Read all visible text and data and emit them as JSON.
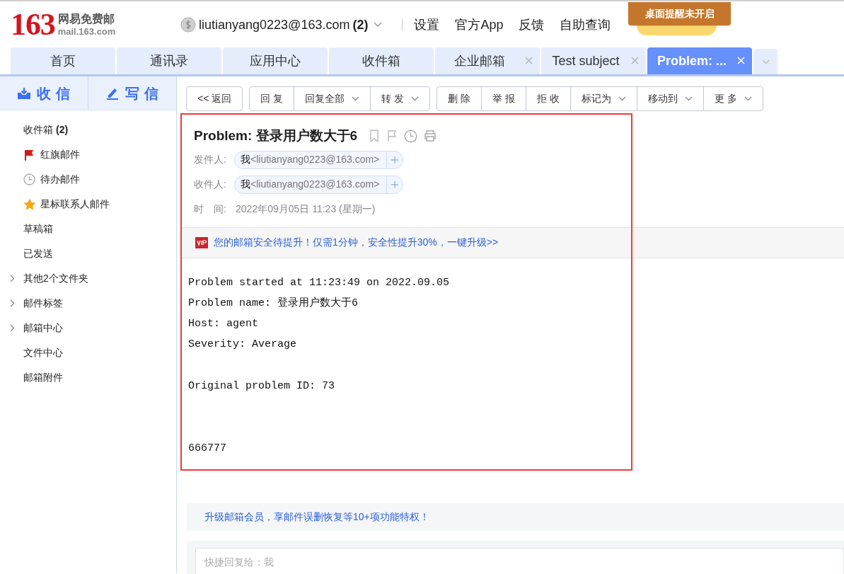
{
  "header": {
    "logo": {
      "number": "163",
      "name": "网易免费邮",
      "domain": "mail.163.com"
    },
    "account": {
      "email": "liutianyang0223@163.com",
      "count": "(2)"
    },
    "links": [
      "设置",
      "官方App",
      "反馈",
      "自助查询"
    ],
    "notice": "桌面提醒未开启"
  },
  "tabs": [
    {
      "label": "首页",
      "selected": false,
      "closable": false
    },
    {
      "label": "通讯录",
      "selected": false,
      "closable": false
    },
    {
      "label": "应用中心",
      "selected": false,
      "closable": false
    },
    {
      "label": "收件箱",
      "selected": false,
      "closable": false
    },
    {
      "label": "企业邮箱",
      "selected": false,
      "closable": true
    },
    {
      "label": "Test subject",
      "selected": false,
      "closable": true
    },
    {
      "label": "Problem: ...",
      "selected": true,
      "closable": true
    }
  ],
  "sidebar": {
    "actions": [
      {
        "kind": "receive",
        "label": "收 信"
      },
      {
        "kind": "compose",
        "label": "写 信"
      }
    ],
    "folders": [
      {
        "label": "收件箱",
        "count": "(2)",
        "kind": "plain"
      },
      {
        "label": "红旗邮件",
        "kind": "flag"
      },
      {
        "label": "待办邮件",
        "kind": "clock"
      },
      {
        "label": "星标联系人邮件",
        "kind": "star"
      },
      {
        "label": "草稿箱",
        "kind": "plain"
      },
      {
        "label": "已发送",
        "kind": "plain"
      },
      {
        "label": "其他2个文件夹",
        "kind": "group"
      },
      {
        "label": "邮件标签",
        "kind": "group"
      },
      {
        "label": "邮箱中心",
        "kind": "group"
      },
      {
        "label": "文件中心",
        "kind": "plain"
      },
      {
        "label": "邮箱附件",
        "kind": "plain"
      }
    ]
  },
  "toolbar": [
    [
      {
        "label": "<< 返回",
        "dropdown": false
      }
    ],
    [
      {
        "label": "回 复",
        "dropdown": false
      },
      {
        "label": "回复全部",
        "dropdown": true
      },
      {
        "label": "转 发",
        "dropdown": true
      }
    ],
    [
      {
        "label": "删 除",
        "dropdown": false
      },
      {
        "label": "举 报",
        "dropdown": false
      },
      {
        "label": "拒 收",
        "dropdown": false
      },
      {
        "label": "标记为",
        "dropdown": true
      },
      {
        "label": "移动到",
        "dropdown": true
      },
      {
        "label": "更 多",
        "dropdown": true
      }
    ]
  ],
  "message": {
    "subject": "Problem: 登录用户数大于6",
    "from": {
      "label": "发件人:",
      "name": "我",
      "address": "<liutianyang0223@163.com>"
    },
    "to": {
      "label": "收件人:",
      "name": "我",
      "address": "<liutianyang0223@163.com>"
    },
    "time": {
      "label": "时　间:",
      "value": "2022年09月05日 11:23 (星期一)"
    },
    "promo": "您的邮箱安全待提升！仅需1分钟，安全性提升30%，一键升级>>",
    "body": "Problem started at 11:23:49 on 2022.09.05\nProblem name: 登录用户数大于6\nHost: agent\nSeverity: Average\n\nOriginal problem ID: 73\n\n\n666777"
  },
  "footer": {
    "promo": "升级邮箱会员，享邮件误删恢复等10+项功能特权！",
    "reply_placeholder": "快捷回复给：我"
  }
}
